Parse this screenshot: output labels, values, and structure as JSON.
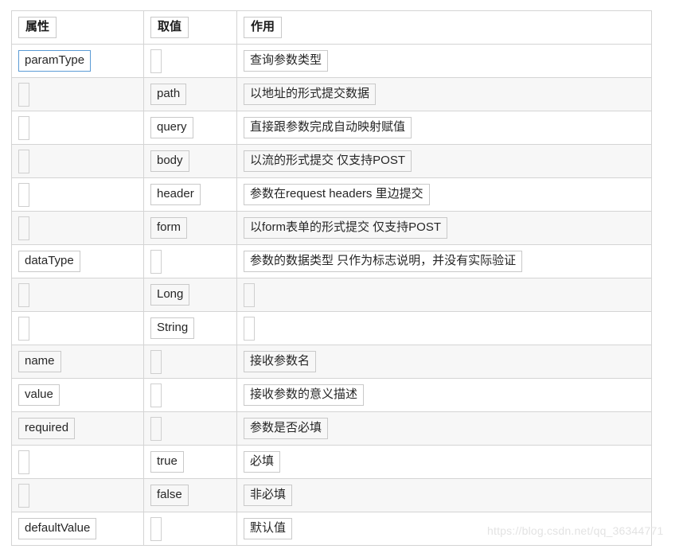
{
  "table": {
    "columns": [
      {
        "key": "attribute",
        "label": "属性"
      },
      {
        "key": "value",
        "label": "取值"
      },
      {
        "key": "effect",
        "label": "作用"
      }
    ],
    "rows": [
      {
        "attribute": "paramType",
        "value": "",
        "effect": "查询参数类型",
        "attribute_focused": true
      },
      {
        "attribute": "",
        "value": "path",
        "effect": "以地址的形式提交数据"
      },
      {
        "attribute": "",
        "value": "query",
        "effect": "直接跟参数完成自动映射赋值"
      },
      {
        "attribute": "",
        "value": "body",
        "effect": "以流的形式提交 仅支持POST"
      },
      {
        "attribute": "",
        "value": "header",
        "effect": "参数在request headers 里边提交"
      },
      {
        "attribute": "",
        "value": "form",
        "effect": "以form表单的形式提交 仅支持POST"
      },
      {
        "attribute": "dataType",
        "value": "",
        "effect": "参数的数据类型 只作为标志说明，并没有实际验证"
      },
      {
        "attribute": "",
        "value": "Long",
        "effect": ""
      },
      {
        "attribute": "",
        "value": "String",
        "effect": ""
      },
      {
        "attribute": "name",
        "value": "",
        "effect": "接收参数名"
      },
      {
        "attribute": "value",
        "value": "",
        "effect": "接收参数的意义描述"
      },
      {
        "attribute": "required",
        "value": "",
        "effect": "参数是否必填"
      },
      {
        "attribute": "",
        "value": "true",
        "effect": "必填"
      },
      {
        "attribute": "",
        "value": "false",
        "effect": "非必填"
      },
      {
        "attribute": "defaultValue",
        "value": "",
        "effect": "默认值"
      }
    ]
  },
  "watermark": {
    "text": "https://blog.csdn.net/qq_36344771"
  },
  "colors": {
    "focus_border": "#5b9bd5",
    "chip_border": "#c9c9c9",
    "cell_border": "#d4d4d4",
    "zebra_row": "#f7f7f7",
    "page_background": "#ffffff",
    "watermark": "#e3e3e3"
  }
}
